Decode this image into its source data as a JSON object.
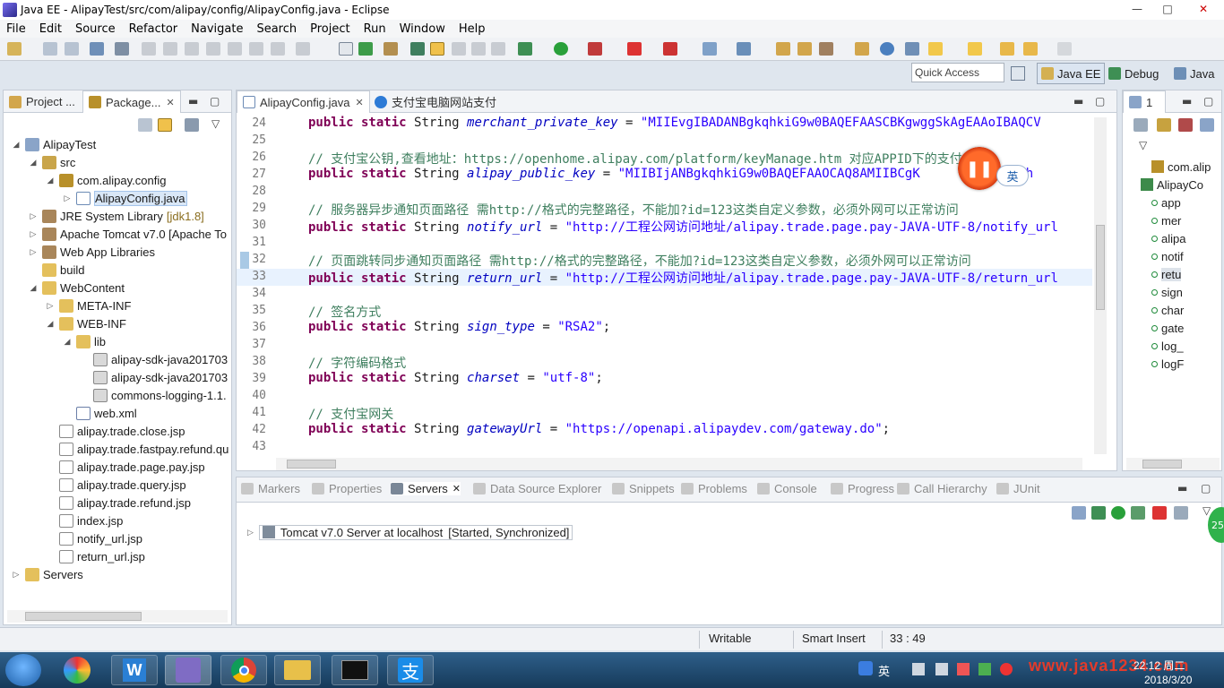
{
  "window": {
    "title": "Java EE - AlipayTest/src/com/alipay/config/AlipayConfig.java - Eclipse",
    "controls": [
      "—",
      "□",
      "✕"
    ]
  },
  "menu": [
    "File",
    "Edit",
    "Source",
    "Refactor",
    "Navigate",
    "Search",
    "Project",
    "Run",
    "Window",
    "Help"
  ],
  "quick_access": {
    "placeholder": "Quick Access"
  },
  "perspectives": {
    "javaee": "Java EE",
    "debug": "Debug",
    "java": "Java"
  },
  "explorer": {
    "tabs": {
      "project": "Project ...",
      "package": "Package..."
    },
    "tree": [
      {
        "label": "AlipayTest",
        "icon": "project-icon",
        "indent": 0,
        "arrow": "◢"
      },
      {
        "label": "src",
        "icon": "source-folder-icon",
        "indent": 1,
        "arrow": "◢"
      },
      {
        "label": "com.alipay.config",
        "icon": "package-icon",
        "indent": 2,
        "arrow": "◢"
      },
      {
        "label": "AlipayConfig.java",
        "icon": "java-file-icon",
        "indent": 3,
        "arrow": "▷",
        "selected": true
      },
      {
        "label": "JRE System Library",
        "icon": "library-icon",
        "indent": 1,
        "arrow": "▷",
        "deco": "[jdk1.8]"
      },
      {
        "label": "Apache Tomcat v7.0 [Apache To",
        "icon": "library-icon",
        "indent": 1,
        "arrow": "▷"
      },
      {
        "label": "Web App Libraries",
        "icon": "library-icon",
        "indent": 1,
        "arrow": "▷"
      },
      {
        "label": "build",
        "icon": "folder-icon",
        "indent": 1,
        "arrow": ""
      },
      {
        "label": "WebContent",
        "icon": "folder-icon",
        "indent": 1,
        "arrow": "◢"
      },
      {
        "label": "META-INF",
        "icon": "folder-icon",
        "indent": 2,
        "arrow": "▷"
      },
      {
        "label": "WEB-INF",
        "icon": "folder-icon",
        "indent": 2,
        "arrow": "◢"
      },
      {
        "label": "lib",
        "icon": "folder-icon",
        "indent": 3,
        "arrow": "◢"
      },
      {
        "label": "alipay-sdk-java201703",
        "icon": "jar-icon",
        "indent": 4,
        "arrow": ""
      },
      {
        "label": "alipay-sdk-java201703",
        "icon": "jar-icon",
        "indent": 4,
        "arrow": ""
      },
      {
        "label": "commons-logging-1.1.",
        "icon": "jar-icon",
        "indent": 4,
        "arrow": ""
      },
      {
        "label": "web.xml",
        "icon": "xml-file-icon",
        "indent": 3,
        "arrow": ""
      },
      {
        "label": "alipay.trade.close.jsp",
        "icon": "jsp-file-icon",
        "indent": 2,
        "arrow": ""
      },
      {
        "label": "alipay.trade.fastpay.refund.qu",
        "icon": "jsp-file-icon",
        "indent": 2,
        "arrow": ""
      },
      {
        "label": "alipay.trade.page.pay.jsp",
        "icon": "jsp-file-icon",
        "indent": 2,
        "arrow": ""
      },
      {
        "label": "alipay.trade.query.jsp",
        "icon": "jsp-file-icon",
        "indent": 2,
        "arrow": ""
      },
      {
        "label": "alipay.trade.refund.jsp",
        "icon": "jsp-file-icon",
        "indent": 2,
        "arrow": ""
      },
      {
        "label": "index.jsp",
        "icon": "jsp-file-icon",
        "indent": 2,
        "arrow": ""
      },
      {
        "label": "notify_url.jsp",
        "icon": "jsp-file-icon",
        "indent": 2,
        "arrow": ""
      },
      {
        "label": "return_url.jsp",
        "icon": "jsp-file-icon",
        "indent": 2,
        "arrow": ""
      },
      {
        "label": "Servers",
        "icon": "folder-icon",
        "indent": 0,
        "arrow": "▷"
      }
    ]
  },
  "editor": {
    "tabs": [
      {
        "label": "AlipayConfig.java",
        "active": true
      },
      {
        "label": "支付宝电脑网站支付",
        "active": false
      }
    ],
    "lines": [
      {
        "n": "24",
        "parts": [
          [
            "kw",
            "public static "
          ],
          [
            "",
            "String "
          ],
          [
            "fld",
            "merchant_private_key"
          ],
          [
            "",
            " = "
          ],
          [
            "str",
            "\"MIIEvgIBADANBgkqhkiG9w0BAQEFAASCBKgwggSkAgEAAoIBAQCV"
          ]
        ]
      },
      {
        "n": "25",
        "parts": []
      },
      {
        "n": "26",
        "parts": [
          [
            "cmt",
            "// 支付宝公钥,查看地址：https://openhome.alipay.com/platform/keyManage.htm 对应APPID下的支付"
          ]
        ]
      },
      {
        "n": "27",
        "parts": [
          [
            "kw",
            "public static "
          ],
          [
            "",
            "String "
          ],
          [
            "fld",
            "alipay_public_key"
          ],
          [
            "",
            " = "
          ],
          [
            "str",
            "\"MIIBIjANBgkqhkiG9w0BAQEFAAOCAQ8AMIIBCgK       LOzswOwh"
          ]
        ]
      },
      {
        "n": "28",
        "parts": []
      },
      {
        "n": "29",
        "parts": [
          [
            "cmt",
            "// 服务器异步通知页面路径 需http://格式的完整路径，不能加?id=123这类自定义参数，必须外网可以正常访问"
          ]
        ]
      },
      {
        "n": "30",
        "parts": [
          [
            "kw",
            "public static "
          ],
          [
            "",
            "String "
          ],
          [
            "fld",
            "notify_url"
          ],
          [
            "",
            " = "
          ],
          [
            "str",
            "\"http://工程公网访问地址/alipay.trade.page.pay-JAVA-UTF-8/notify_url"
          ]
        ]
      },
      {
        "n": "31",
        "parts": []
      },
      {
        "n": "32",
        "parts": [
          [
            "cmt",
            "// 页面跳转同步通知页面路径 需http://格式的完整路径，不能加?id=123这类自定义参数，必须外网可以正常访问"
          ]
        ]
      },
      {
        "n": "33",
        "current": true,
        "parts": [
          [
            "kw",
            "public static "
          ],
          [
            "",
            "String "
          ],
          [
            "fld",
            "return_url"
          ],
          [
            "",
            " = "
          ],
          [
            "str",
            "\"http://工程公网访问地址/alipay.trade.page.pay-JAVA-UTF-8/return_url"
          ]
        ]
      },
      {
        "n": "34",
        "parts": []
      },
      {
        "n": "35",
        "parts": [
          [
            "cmt",
            "// 签名方式"
          ]
        ]
      },
      {
        "n": "36",
        "parts": [
          [
            "kw",
            "public static "
          ],
          [
            "",
            "String "
          ],
          [
            "fld",
            "sign_type"
          ],
          [
            "",
            " = "
          ],
          [
            "str",
            "\"RSA2\""
          ],
          [
            "",
            ";"
          ]
        ]
      },
      {
        "n": "37",
        "parts": []
      },
      {
        "n": "38",
        "parts": [
          [
            "cmt",
            "// 字符编码格式"
          ]
        ]
      },
      {
        "n": "39",
        "parts": [
          [
            "kw",
            "public static "
          ],
          [
            "",
            "String "
          ],
          [
            "fld",
            "charset"
          ],
          [
            "",
            " = "
          ],
          [
            "str",
            "\"utf-8\""
          ],
          [
            "",
            ";"
          ]
        ]
      },
      {
        "n": "40",
        "parts": []
      },
      {
        "n": "41",
        "parts": [
          [
            "cmt",
            "// 支付宝网关"
          ]
        ]
      },
      {
        "n": "42",
        "parts": [
          [
            "kw",
            "public static "
          ],
          [
            "",
            "String "
          ],
          [
            "fld",
            "gatewayUrl"
          ],
          [
            "",
            " = "
          ],
          [
            "str",
            "\"https://openapi.alipaydev.com/gateway.do\""
          ],
          [
            "",
            ";"
          ]
        ]
      },
      {
        "n": "43",
        "parts": []
      }
    ]
  },
  "outline": {
    "tab": "1",
    "items": [
      {
        "label": "com.alip",
        "type": "package"
      },
      {
        "label": "AlipayCo",
        "type": "class"
      },
      {
        "label": "app",
        "type": "field"
      },
      {
        "label": "mer",
        "type": "field"
      },
      {
        "label": "alipa",
        "type": "field"
      },
      {
        "label": "notif",
        "type": "field"
      },
      {
        "label": "retu",
        "type": "field",
        "selected": true
      },
      {
        "label": "sign",
        "type": "field"
      },
      {
        "label": "char",
        "type": "field"
      },
      {
        "label": "gate",
        "type": "field"
      },
      {
        "label": "log_",
        "type": "field"
      },
      {
        "label": "logF",
        "type": "field"
      }
    ]
  },
  "bottom": {
    "tabs": [
      "Markers",
      "Properties",
      "Servers",
      "Data Source Explorer",
      "Snippets",
      "Problems",
      "Console",
      "Progress",
      "Call Hierarchy",
      "JUnit"
    ],
    "server": {
      "name": "Tomcat v7.0 Server at localhost",
      "state": "[Started, Synchronized]"
    }
  },
  "status": {
    "writable": "Writable",
    "insert_mode": "Smart Insert",
    "position": "33 : 49"
  },
  "overlay": {
    "ime": "英",
    "badge": "25"
  },
  "taskbar": {
    "lang": "英",
    "time": "22:12 周二",
    "date": "2018/3/20",
    "watermark": "www.java1234.com"
  },
  "colors": {
    "keyword": "#7f0055",
    "field": "#0000c0",
    "string": "#2a00ff",
    "comment": "#3f7f5f",
    "current_line": "#e8f2fe"
  }
}
